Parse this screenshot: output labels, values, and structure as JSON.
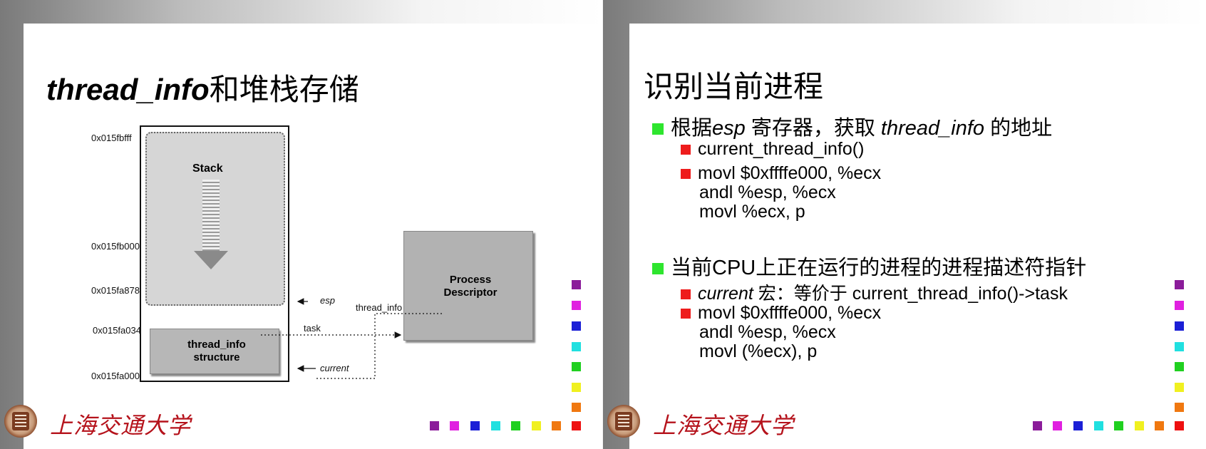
{
  "left_slide": {
    "title_italic": "thread_info",
    "title_rest": "和堆栈存储",
    "diagram": {
      "addresses": [
        "0x015fbfff",
        "0x015fb000",
        "0x015fa878",
        "0x015fa034",
        "0x015fa000"
      ],
      "stack_label": "Stack",
      "thread_info_box": "thread_info structure",
      "process_descriptor_box": "Process Descriptor",
      "pointer_esp": "esp",
      "pointer_current": "current",
      "link_thread_info": "thread_info",
      "link_task": "task"
    }
  },
  "right_slide": {
    "title": "识别当前进程",
    "bullet1": {
      "pre": "根据",
      "esp": "esp",
      "mid": " 寄存器，获取 ",
      "ti": "thread_info",
      "post": " 的地址",
      "sub1": "current_thread_info()",
      "sub2": [
        "movl $0xffffe000, %ecx",
        "andl %esp, %ecx",
        "movl %ecx, p"
      ]
    },
    "bullet2": {
      "text": "当前CPU上正在运行的进程的进程描述符指针",
      "sub1_italic": "current",
      "sub1_rest": " 宏：等价于  current_thread_info()->task",
      "sub2": [
        "movl $0xffffe000, %ecx",
        "andl %esp, %ecx",
        "movl (%ecx), p"
      ]
    }
  },
  "footer": {
    "university_name": "上海交通大学",
    "square_colors": [
      "#8b1c9a",
      "#e020e0",
      "#1b1fd6",
      "#20e0e0",
      "#20d020",
      "#f0f020",
      "#f07810",
      "#ee1010"
    ]
  }
}
